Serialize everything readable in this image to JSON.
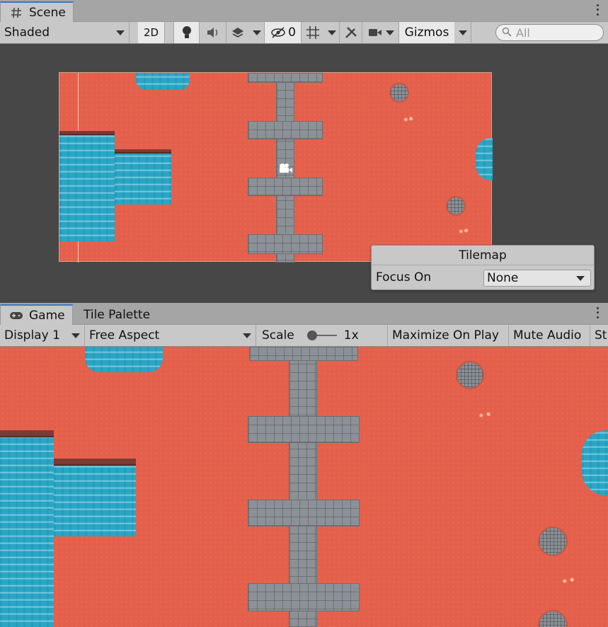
{
  "scene_panel": {
    "tab_label": "Scene",
    "tab_icon": "hash-icon",
    "toolbar": {
      "shading_mode": "Shaded",
      "mode_2d": "2D",
      "hidden_count": "0",
      "gizmos_label": "Gizmos",
      "search_placeholder": "All"
    }
  },
  "tilemap_overlay": {
    "title": "Tilemap",
    "focus_on_label": "Focus On",
    "focus_on_value": "None"
  },
  "game_panel": {
    "tabs": [
      {
        "label": "Game",
        "icon": "gamepad-icon",
        "active": true
      },
      {
        "label": "Tile Palette",
        "active": false
      }
    ],
    "toolbar": {
      "display": "Display 1",
      "aspect": "Free Aspect",
      "scale_label": "Scale",
      "scale_value": "1x",
      "scale_level": 0,
      "maximize_on_play": "Maximize On Play",
      "mute_audio": "Mute Audio",
      "truncated_item": "St"
    }
  },
  "colors": {
    "ground": "#e4604b",
    "water": "#2aa6c5",
    "stone": "#8b9196",
    "editor_bg": "#c8c8c8",
    "scene_bg": "#474747",
    "active_tab_accent": "#3a79c2"
  }
}
